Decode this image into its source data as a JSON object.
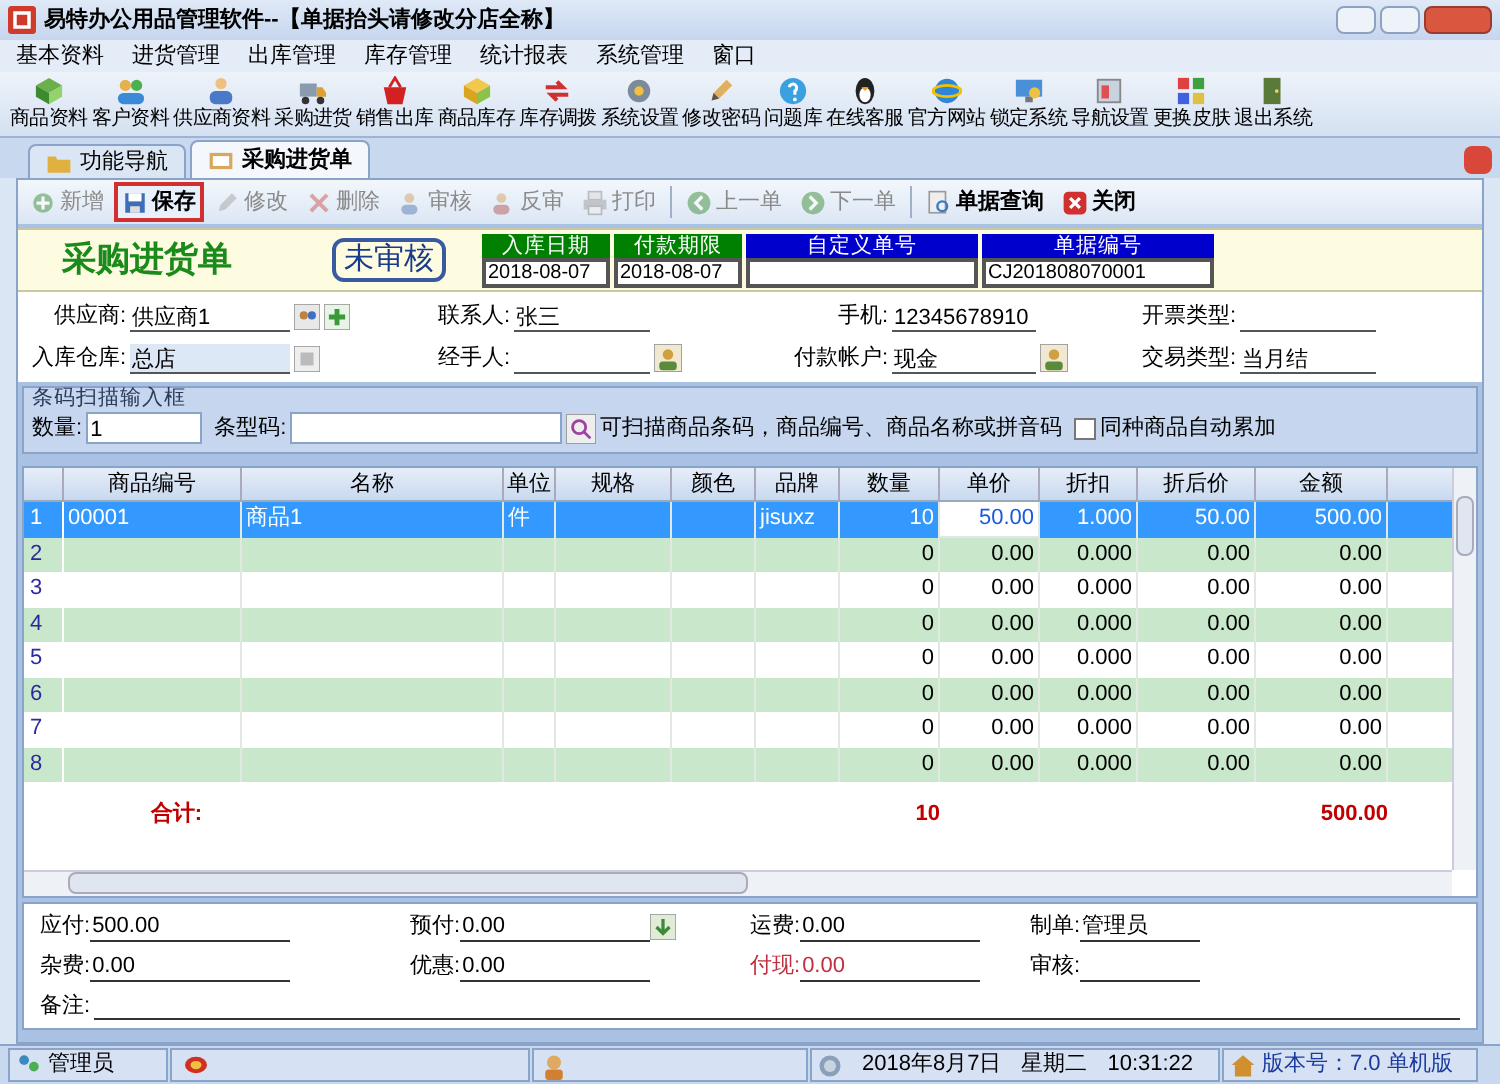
{
  "window": {
    "title": "易特办公用品管理软件--【单据抬头请修改分店全称】"
  },
  "menu": [
    "基本资料",
    "进货管理",
    "出库管理",
    "库存管理",
    "统计报表",
    "系统管理",
    "窗口"
  ],
  "toolbar": [
    "商品资料",
    "客户资料",
    "供应商资料",
    "采购进货",
    "销售出库",
    "商品库存",
    "库存调拨",
    "系统设置",
    "修改密码",
    "问题库",
    "在线客服",
    "官方网站",
    "锁定系统",
    "导航设置",
    "更换皮肤",
    "退出系统"
  ],
  "tabs": [
    {
      "label": "功能导航",
      "selected": false
    },
    {
      "label": "采购进货单",
      "selected": true
    }
  ],
  "doc_toolbar": [
    {
      "label": "新增",
      "disabled": true,
      "selected": false
    },
    {
      "label": "保存",
      "disabled": false,
      "selected": true
    },
    {
      "label": "修改",
      "disabled": true,
      "selected": false
    },
    {
      "label": "删除",
      "disabled": true,
      "selected": false
    },
    {
      "label": "审核",
      "disabled": true,
      "selected": false
    },
    {
      "label": "反审",
      "disabled": true,
      "selected": false
    },
    {
      "label": "打印",
      "disabled": true,
      "selected": false
    },
    {
      "label": "上一单",
      "disabled": true,
      "selected": false
    },
    {
      "label": "下一单",
      "disabled": true,
      "selected": false
    },
    {
      "label": "单据查询",
      "disabled": false,
      "selected": false
    },
    {
      "label": "关闭",
      "disabled": false,
      "selected": false
    }
  ],
  "document": {
    "title": "采购进货单",
    "status": "未审核",
    "header_fields": [
      {
        "label": "入库日期",
        "value": "2018-08-07",
        "color": "#008000"
      },
      {
        "label": "付款期限",
        "value": "2018-08-07",
        "color": "#008000"
      },
      {
        "label": "自定义单号",
        "color": "#0000cc"
      },
      {
        "label": "单据编号",
        "value": "CJ201808070001",
        "color": "#0000cc"
      }
    ]
  },
  "form": [
    {
      "label": "供应商:",
      "value": "供应商1"
    },
    {
      "label": "联系人:",
      "value": "张三"
    },
    {
      "label": "手机:",
      "value": "12345678910"
    },
    {
      "label": "开票类型:"
    },
    {
      "label": "入库仓库:",
      "value": "总店"
    },
    {
      "label": "经手人:"
    },
    {
      "label": "付款帐户:",
      "value": "现金"
    },
    {
      "label": "交易类型:",
      "value": "当月结"
    }
  ],
  "scan": {
    "title": "条码扫描输入框",
    "quantity_label": "数量:",
    "quantity": "1",
    "barcode_label": "条型码:",
    "hint": "可扫描商品条码，商品编号、商品名称或拼音码",
    "checkbox": {
      "label": "同种商品自动累加",
      "checked": false
    }
  },
  "table": {
    "columns": [
      "商品编号",
      "名称",
      "单位",
      "规格",
      "颜色",
      "品牌",
      "数量",
      "单价",
      "折扣",
      "折后价",
      "金额"
    ],
    "rows": [
      {
        "number": "1",
        "selected": true,
        "cells": [
          "00001",
          "商品1",
          "件",
          null,
          null,
          "jisuxz",
          "10",
          {
            "text": "50.00",
            "editing": true
          },
          "1.000",
          "50.00",
          "500.00"
        ]
      },
      {
        "number": "2",
        "selected": false,
        "cells": [
          null,
          null,
          null,
          null,
          null,
          null,
          "0",
          "0.00",
          "0.000",
          "0.00",
          "0.00"
        ]
      },
      {
        "number": "3",
        "selected": false,
        "cells": [
          null,
          null,
          null,
          null,
          null,
          null,
          "0",
          "0.00",
          "0.000",
          "0.00",
          "0.00"
        ]
      },
      {
        "number": "4",
        "selected": false,
        "cells": [
          null,
          null,
          null,
          null,
          null,
          null,
          "0",
          "0.00",
          "0.000",
          "0.00",
          "0.00"
        ]
      },
      {
        "number": "5",
        "selected": false,
        "cells": [
          null,
          null,
          null,
          null,
          null,
          null,
          "0",
          "0.00",
          "0.000",
          "0.00",
          "0.00"
        ]
      },
      {
        "number": "6",
        "selected": false,
        "cells": [
          null,
          null,
          null,
          null,
          null,
          null,
          "0",
          "0.00",
          "0.000",
          "0.00",
          "0.00"
        ]
      },
      {
        "number": "7",
        "selected": false,
        "cells": [
          null,
          null,
          null,
          null,
          null,
          null,
          "0",
          "0.00",
          "0.000",
          "0.00",
          "0.00"
        ]
      },
      {
        "number": "8",
        "selected": false,
        "cells": [
          null,
          null,
          null,
          null,
          null,
          null,
          "0",
          "0.00",
          "0.000",
          "0.00",
          "0.00"
        ]
      }
    ],
    "totals": {
      "label": "合计:",
      "qty": "10",
      "amount": "500.00"
    }
  },
  "summary": [
    {
      "label": "应付:",
      "value": "500.00",
      "emphasis": false
    },
    {
      "label": "预付:",
      "value": "0.00",
      "emphasis": false
    },
    {
      "label": "运费:",
      "value": "0.00",
      "emphasis": false
    },
    {
      "label": "制单:",
      "value": "管理员",
      "emphasis": false
    },
    {
      "label": "杂费:",
      "value": "0.00",
      "emphasis": false
    },
    {
      "label": "优惠:",
      "value": "0.00",
      "emphasis": false
    },
    {
      "label": "付现:",
      "value": "0.00",
      "emphasis": true
    },
    {
      "label": "审核:",
      "emphasis": false
    }
  ],
  "remark_label": "备注:",
  "status_bar": {
    "user": "管理员",
    "date": "2018年8月7日",
    "weekday": "星期二",
    "time": "10:31:22",
    "version": "版本号：7.0 单机版"
  }
}
